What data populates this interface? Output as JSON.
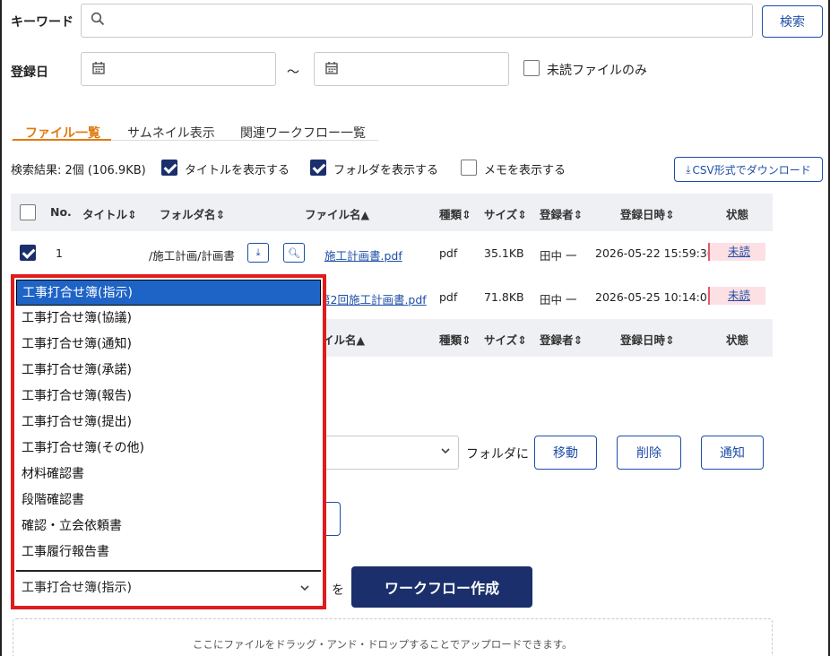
{
  "search": {
    "keyword_label": "キーワード",
    "keyword_value": "",
    "search_button": "検索",
    "date_label": "登録日",
    "date_from": "",
    "date_to": "",
    "range_sep": "～",
    "unread_only_label": "未読ファイルのみ",
    "unread_only_checked": false
  },
  "tabs": [
    {
      "label": "ファイル一覧",
      "active": true
    },
    {
      "label": "サムネイル表示",
      "active": false
    },
    {
      "label": "関連ワークフロー一覧",
      "active": false
    }
  ],
  "options": {
    "result_summary": "検索結果: 2個 (106.9KB)",
    "show_title_label": "タイトルを表示する",
    "show_folder_label": "フォルダを表示する",
    "show_memo_label": "メモを表示する",
    "csv_download": "CSV形式でダウンロード"
  },
  "table": {
    "headers": {
      "no": "No.",
      "title": "タイトル",
      "folder": "フォルダ名",
      "file": "ファイル名",
      "type": "種類",
      "size": "サイズ",
      "user": "登録者",
      "date": "登録日時",
      "status": "状態"
    },
    "footer_file_header": "イル名",
    "rows": [
      {
        "no": "1",
        "folder": "/施工計画/計画書",
        "file": "施工計画書.pdf",
        "type": "pdf",
        "size": "35.1KB",
        "user": "田中 一",
        "date": "2026-05-22 15:59:36",
        "status": "未読",
        "checked": true
      },
      {
        "file": "第2回施工計画書.pdf",
        "type": "pdf",
        "size": "71.8KB",
        "user": "田中 一",
        "date": "2026-05-25 10:14:07",
        "status": "未読"
      }
    ]
  },
  "actions": {
    "folder_to": "フォルダに",
    "move": "移動",
    "delete": "削除",
    "notify": "通知",
    "workflow_suffix": "を",
    "create_workflow": "ワークフロー作成"
  },
  "workflow_dropdown": {
    "selected": "工事打合せ簿(指示)",
    "items": [
      "工事打合せ簿(指示)",
      "工事打合せ簿(協議)",
      "工事打合せ簿(通知)",
      "工事打合せ簿(承諾)",
      "工事打合せ簿(報告)",
      "工事打合せ簿(提出)",
      "工事打合せ簿(その他)",
      "材料確認書",
      "段階確認書",
      "確認・立会依頼書",
      "工事履行報告書"
    ]
  },
  "dropzone": {
    "text": "ここにファイルをドラッグ・アンド・ドロップすることでアップロードできます。"
  }
}
